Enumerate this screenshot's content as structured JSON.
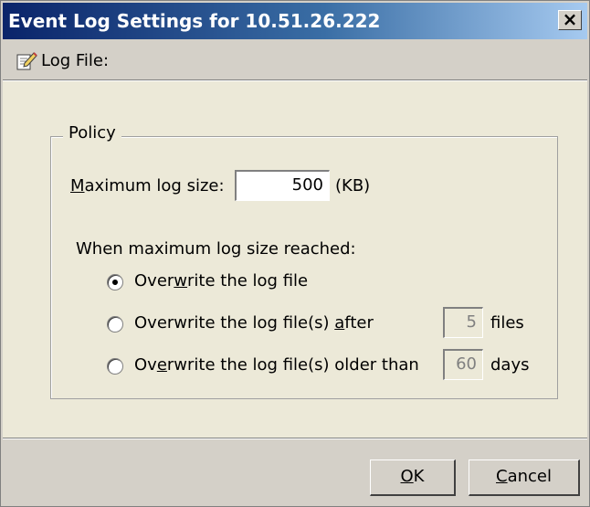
{
  "window": {
    "title": "Event Log Settings for 10.51.26.222",
    "close_label": "×"
  },
  "subheader": {
    "icon": "edit-document-icon",
    "label": "Log File:"
  },
  "policy": {
    "legend": "Policy",
    "max_size": {
      "label_prefix": "",
      "label_u": "M",
      "label_rest": "aximum log size:",
      "value": "500",
      "unit": "(KB)"
    },
    "when_label": "When maximum log size reached:",
    "options": [
      {
        "pre": "Over",
        "u": "w",
        "post": "rite the log file",
        "selected": true
      },
      {
        "pre": "Overwrite the log file(s) ",
        "u": "a",
        "post": "fter",
        "value": "5",
        "suffix": "files",
        "selected": false
      },
      {
        "pre": "Ov",
        "u": "e",
        "post": "rwrite the log file(s) older than",
        "value": "60",
        "suffix": "days",
        "selected": false
      }
    ]
  },
  "buttons": {
    "ok": {
      "u": "O",
      "rest": "K"
    },
    "cancel": {
      "u": "C",
      "rest": "ancel"
    }
  }
}
